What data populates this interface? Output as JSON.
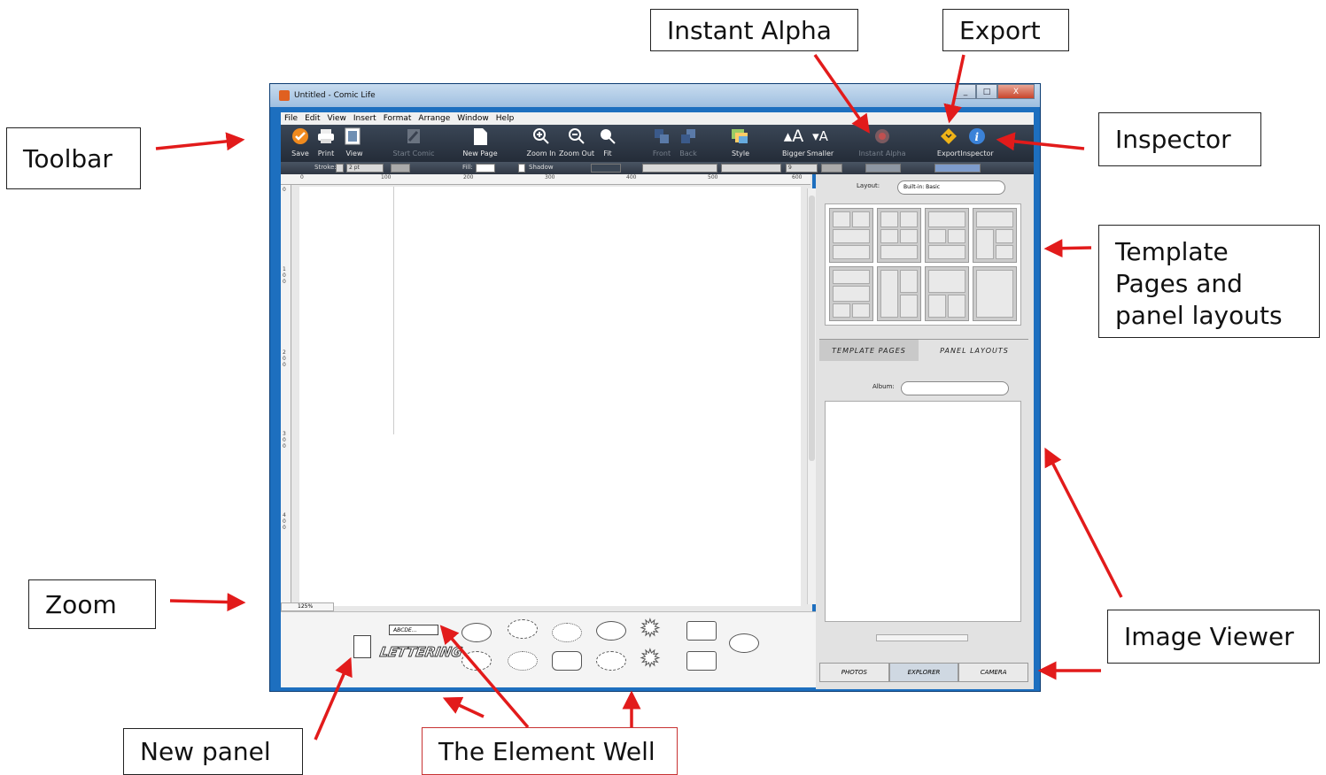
{
  "window": {
    "title": "Untitled - Comic Life",
    "controls": [
      "_",
      "□",
      "X"
    ]
  },
  "menu": [
    "File",
    "Edit",
    "View",
    "Insert",
    "Format",
    "Arrange",
    "Window",
    "Help"
  ],
  "toolbar": {
    "items": [
      {
        "label": "Save",
        "icon": "save-icon",
        "enabled": true
      },
      {
        "label": "Print",
        "icon": "print-icon",
        "enabled": true
      },
      {
        "label": "View",
        "icon": "view-icon",
        "enabled": true
      },
      {
        "label": "Start Comic",
        "icon": "start-comic-icon",
        "enabled": false
      },
      {
        "label": "New Page",
        "icon": "new-page-icon",
        "enabled": true
      },
      {
        "label": "Zoom In",
        "icon": "zoom-in-icon",
        "enabled": true
      },
      {
        "label": "Zoom Out",
        "icon": "zoom-out-icon",
        "enabled": true
      },
      {
        "label": "Fit",
        "icon": "fit-icon",
        "enabled": true
      },
      {
        "label": "Front",
        "icon": "front-icon",
        "enabled": false
      },
      {
        "label": "Back",
        "icon": "back-icon",
        "enabled": false
      },
      {
        "label": "Style",
        "icon": "style-icon",
        "enabled": true
      },
      {
        "label": "Bigger",
        "icon": "bigger-icon",
        "enabled": true
      },
      {
        "label": "Smaller",
        "icon": "smaller-icon",
        "enabled": true
      },
      {
        "label": "Instant Alpha",
        "icon": "instant-alpha-icon",
        "enabled": false
      },
      {
        "label": "Export",
        "icon": "export-icon",
        "enabled": true
      },
      {
        "label": "Inspector",
        "icon": "inspector-icon",
        "enabled": true
      }
    ]
  },
  "format_bar": {
    "stroke_label": "Stroke:",
    "stroke_value": "2 pt",
    "fill_label": "Fill:",
    "shadow_label": "Shadow",
    "font_size": "9"
  },
  "ruler": {
    "h_ticks": [
      "0",
      "100",
      "200",
      "300",
      "400",
      "500",
      "600"
    ],
    "v_ticks": [
      "0",
      "1\n0\n0",
      "2\n0\n0",
      "3\n0\n0",
      "4\n0\n0"
    ]
  },
  "zoom": {
    "value": "125%"
  },
  "inspector": {
    "layout_label": "Layout:",
    "layout_value": "Built-in: Basic",
    "tabs": [
      "TEMPLATE PAGES",
      "PANEL LAYOUTS"
    ],
    "album_label": "Album:",
    "album_value": "",
    "source_tabs": [
      "PHOTOS",
      "EXPLORER",
      "CAMERA"
    ]
  },
  "element_well": {
    "caption_text": "ABCDE...",
    "lettering_text": "LETTERING"
  },
  "annotations": [
    {
      "id": "toolbar",
      "text": "Toolbar"
    },
    {
      "id": "instant-alpha",
      "text": "Instant Alpha"
    },
    {
      "id": "export",
      "text": "Export"
    },
    {
      "id": "inspector",
      "text": "Inspector"
    },
    {
      "id": "template",
      "text": "Template\nPages and\npanel layouts"
    },
    {
      "id": "image-viewer",
      "text": "Image Viewer"
    },
    {
      "id": "zoom",
      "text": "Zoom"
    },
    {
      "id": "new-panel",
      "text": "New panel"
    },
    {
      "id": "element-well",
      "text": "The Element Well"
    }
  ],
  "colors": {
    "arrow": "#e21b1b",
    "toolbar_bg": "#2c3542",
    "window_frame": "#1d6fbf"
  }
}
